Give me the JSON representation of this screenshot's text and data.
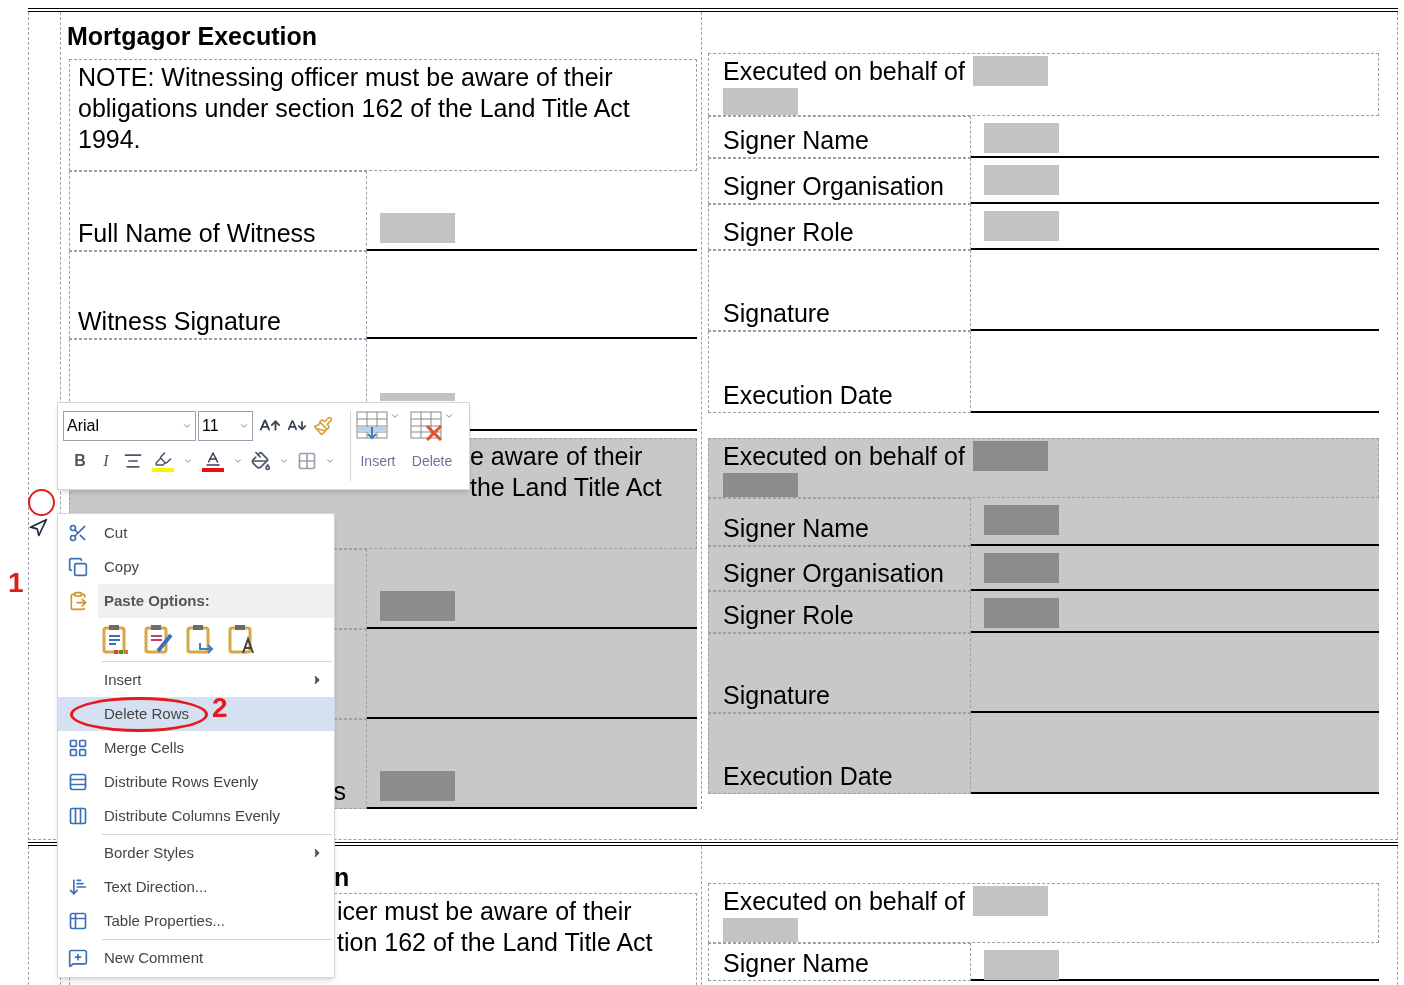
{
  "document": {
    "tables": [
      {
        "title": "Mortgagor Execution",
        "blocks": [
          {
            "selected": false,
            "witness": {
              "note": "NOTE: Witnessing officer must be aware of their obligations under section 162 of the Land Title Act 1994.",
              "rows": [
                {
                  "label": "Full Name of Witness",
                  "has_field": true
                },
                {
                  "label": "Witness Signature",
                  "has_field": false
                },
                {
                  "has_field": true
                }
              ]
            },
            "signer": {
              "heading": "Executed on behalf of",
              "rows": [
                {
                  "label": "Signer Name",
                  "has_field": true
                },
                {
                  "label": "Signer Organisation",
                  "has_field": true
                },
                {
                  "label": "Signer Role",
                  "has_field": true
                },
                {
                  "label": "Signature",
                  "has_field": false
                },
                {
                  "label": "Execution Date",
                  "has_field": false
                }
              ]
            }
          },
          {
            "selected": true,
            "witness": {
              "note_lines": [
                "e aware of their",
                "the Land Title Act"
              ],
              "rows": [
                {
                  "has_field": true
                },
                {
                  "has_field": false
                },
                {
                  "label": "s",
                  "has_field": true
                }
              ]
            },
            "signer": {
              "heading": "Executed on behalf of",
              "rows": [
                {
                  "label": "Signer Name",
                  "has_field": true
                },
                {
                  "label": "Signer Organisation",
                  "has_field": true
                },
                {
                  "label": "Signer Role",
                  "has_field": true
                },
                {
                  "label": "Signature",
                  "has_field": false
                },
                {
                  "label": "Execution Date",
                  "has_field": false
                }
              ]
            }
          }
        ]
      },
      {
        "title": "n",
        "blocks": [
          {
            "selected": false,
            "witness": {
              "note_lines": [
                "icer must be aware of their",
                "tion 162 of the Land Title Act"
              ]
            },
            "signer": {
              "heading": "Executed on behalf of",
              "rows": [
                {
                  "label": "Signer Name",
                  "has_field": true
                }
              ]
            }
          }
        ]
      }
    ]
  },
  "mini_toolbar": {
    "font": "Arial",
    "size": "11",
    "format_buttons": [
      "B",
      "I"
    ],
    "table_buttons": [
      "Insert",
      "Delete"
    ]
  },
  "context_menu": {
    "items": [
      {
        "kind": "item",
        "label": "Cut",
        "selected": false,
        "submenu": false
      },
      {
        "kind": "item",
        "label": "Copy",
        "selected": false,
        "submenu": false
      },
      {
        "kind": "header",
        "label": "Paste Options:"
      },
      {
        "kind": "paste_icons"
      },
      {
        "kind": "separator"
      },
      {
        "kind": "item",
        "label": "Insert",
        "selected": false,
        "submenu": true
      },
      {
        "kind": "item",
        "label": "Delete Rows",
        "selected": true,
        "submenu": false
      },
      {
        "kind": "item",
        "label": "Merge Cells",
        "selected": false,
        "submenu": false
      },
      {
        "kind": "item",
        "label": "Distribute Rows Evenly",
        "selected": false,
        "submenu": false
      },
      {
        "kind": "item",
        "label": "Distribute Columns Evenly",
        "selected": false,
        "submenu": false
      },
      {
        "kind": "separator"
      },
      {
        "kind": "item",
        "label": "Border Styles",
        "selected": false,
        "submenu": true
      },
      {
        "kind": "item",
        "label": "Text Direction...",
        "selected": false,
        "submenu": false
      },
      {
        "kind": "item",
        "label": "Table Properties...",
        "selected": false,
        "submenu": false
      },
      {
        "kind": "separator"
      },
      {
        "kind": "item",
        "label": "New Comment",
        "selected": false,
        "submenu": false
      }
    ]
  },
  "annotations": [
    {
      "label": "1"
    },
    {
      "label": "2"
    }
  ]
}
